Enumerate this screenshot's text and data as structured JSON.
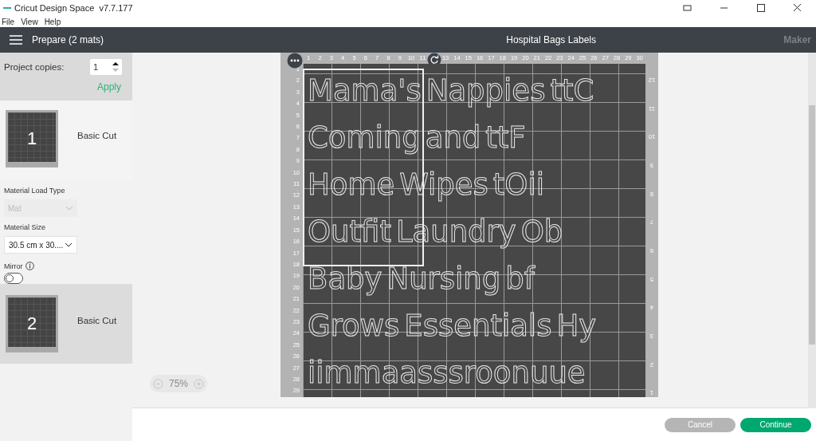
{
  "window": {
    "app_name": "Cricut Design Space",
    "version": "v7.7.177"
  },
  "menu": [
    "File",
    "View",
    "Help"
  ],
  "header": {
    "title": "Prepare (2 mats)",
    "project": "Hospital Bags Labels",
    "machine": "Maker"
  },
  "copies": {
    "label": "Project copies:",
    "value": "1",
    "apply": "Apply"
  },
  "mats": [
    {
      "number": "1",
      "mode": "Basic Cut",
      "selected": true
    },
    {
      "number": "2",
      "mode": "Basic Cut",
      "selected": false
    }
  ],
  "settings": {
    "load_type": {
      "label": "Material Load Type",
      "value": "Mat",
      "disabled": true
    },
    "size": {
      "label": "Material Size",
      "value": "30.5 cm x 30...."
    },
    "mirror": {
      "label": "Mirror",
      "on": false
    }
  },
  "mat_preview": {
    "top_ruler": [
      {
        "kind": "number",
        "label": "1"
      },
      {
        "kind": "number",
        "label": "2"
      },
      {
        "kind": "number",
        "label": "3"
      },
      {
        "kind": "number",
        "label": "4"
      },
      {
        "kind": "number",
        "label": "5"
      },
      {
        "kind": "number",
        "label": "6"
      },
      {
        "kind": "number",
        "label": "7"
      },
      {
        "kind": "number",
        "label": "8"
      },
      {
        "kind": "number",
        "label": "9"
      },
      {
        "kind": "number",
        "label": "10"
      },
      {
        "kind": "number",
        "label": "11"
      },
      {
        "kind": "rotate"
      },
      {
        "kind": "number",
        "label": "13"
      },
      {
        "kind": "number",
        "label": "14"
      },
      {
        "kind": "number",
        "label": "15"
      },
      {
        "kind": "number",
        "label": "16"
      },
      {
        "kind": "number",
        "label": "17"
      },
      {
        "kind": "number",
        "label": "18"
      },
      {
        "kind": "number",
        "label": "19"
      },
      {
        "kind": "number",
        "label": "20"
      },
      {
        "kind": "number",
        "label": "21"
      },
      {
        "kind": "number",
        "label": "22"
      },
      {
        "kind": "number",
        "label": "23"
      },
      {
        "kind": "number",
        "label": "24"
      },
      {
        "kind": "number",
        "label": "25"
      },
      {
        "kind": "number",
        "label": "26"
      },
      {
        "kind": "number",
        "label": "27"
      },
      {
        "kind": "number",
        "label": "28"
      },
      {
        "kind": "number",
        "label": "29"
      },
      {
        "kind": "number",
        "label": "30"
      }
    ],
    "left_ruler": [
      "1",
      "2",
      "3",
      "4",
      "5",
      "6",
      "7",
      "8",
      "9",
      "10",
      "11",
      "12",
      "13",
      "14",
      "15",
      "16",
      "17",
      "18",
      "19",
      "20",
      "21",
      "22",
      "23",
      "24",
      "25",
      "26",
      "27",
      "28",
      "29"
    ],
    "right_ruler": [
      "12",
      "11",
      "10",
      "9",
      "8",
      "7",
      "6",
      "5",
      "4",
      "3",
      "2",
      "1"
    ],
    "lines": [
      [
        "Mama's",
        "Nappies",
        "ttC"
      ],
      [
        "Coming",
        "and",
        "ttF"
      ],
      [
        "Home",
        "Wipes",
        "tOii"
      ],
      [
        "Outfit",
        "Laundry",
        "Ob"
      ],
      [
        "Baby",
        "Nursing",
        "bf"
      ],
      [
        "Grows",
        "Essentials",
        "Hy"
      ],
      [
        "iimmaasssroonuue"
      ]
    ]
  },
  "zoom": {
    "reading": "75%"
  },
  "buttons": [
    {
      "label": "Cancel",
      "kind": "secondary"
    },
    {
      "label": "Continue",
      "kind": "primary"
    }
  ]
}
